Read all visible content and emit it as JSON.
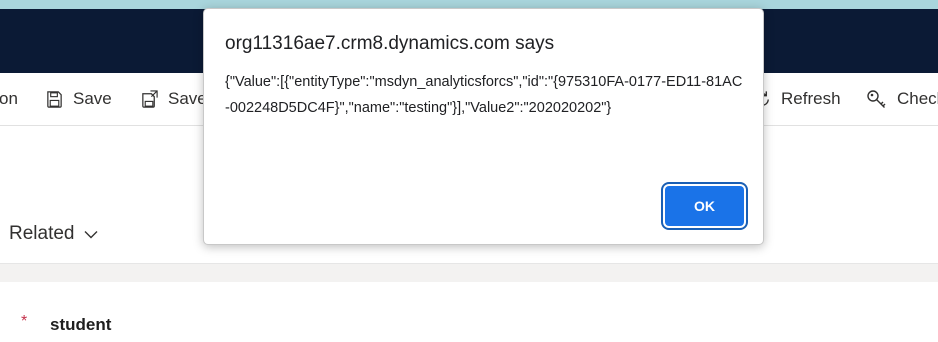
{
  "commandbar": {
    "partial_left_label": "on",
    "save_label": "Save",
    "save_and_close_label": "Save",
    "refresh_label": "Refresh",
    "check_access_label": "Check"
  },
  "form": {
    "related_label": "Related",
    "field_required_marker": "*",
    "field_label": "student"
  },
  "dialog": {
    "title": "org11316ae7.crm8.dynamics.com says",
    "message": "{\"Value\":[{\"entityType\":\"msdyn_analyticsforcs\",\"id\":\"{975310FA-0177-ED11-81AC-002248D5DC4F}\",\"name\":\"testing\"}],\"Value2\":\"202020202\"}",
    "ok_label": "OK"
  },
  "colors": {
    "header": "#0b1a35",
    "accent_strip": "#a9d5dc",
    "ok_button": "#1a73e8",
    "required": "#c4314b"
  }
}
